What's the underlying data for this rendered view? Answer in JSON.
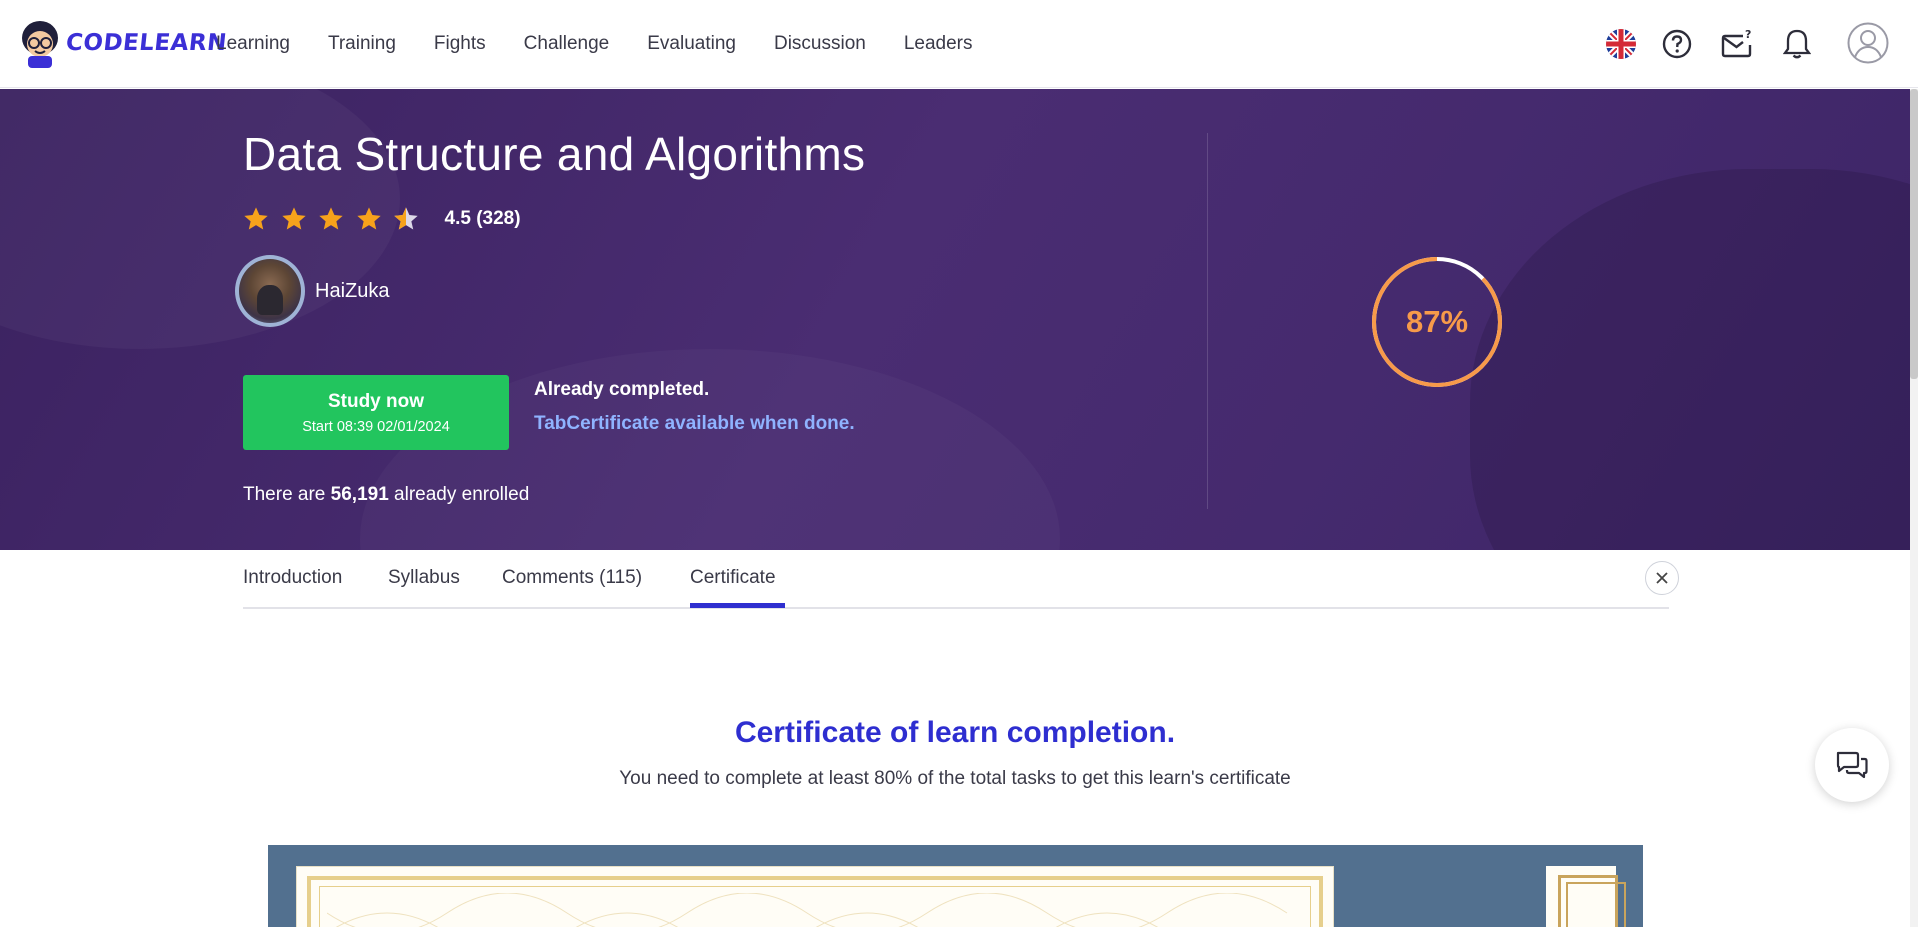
{
  "brand": {
    "name": "CODELEARN"
  },
  "nav": {
    "items": [
      {
        "label": "Learning"
      },
      {
        "label": "Training"
      },
      {
        "label": "Fights"
      },
      {
        "label": "Challenge"
      },
      {
        "label": "Evaluating"
      },
      {
        "label": "Discussion"
      },
      {
        "label": "Leaders"
      }
    ]
  },
  "header_icons": [
    "uk-flag-icon",
    "help-icon",
    "mail-icon",
    "bell-icon",
    "user-avatar-icon"
  ],
  "course": {
    "title": "Data Structure and Algorithms",
    "rating": 4.5,
    "rating_text": "4.5 (328)",
    "author": "HaiZuka",
    "study_button": {
      "label": "Study now",
      "sublabel": "Start 08:39 02/01/2024"
    },
    "status": "Already completed.",
    "certificate_note": "TabCertificate available when done.",
    "enrolled_prefix": "There are ",
    "enrolled_count": "56,191",
    "enrolled_suffix": " already enrolled",
    "progress_percent": 87,
    "progress_label": "87%"
  },
  "tabs": [
    {
      "label": "Introduction"
    },
    {
      "label": "Syllabus"
    },
    {
      "label": "Comments (115)"
    },
    {
      "label": "Certificate",
      "active": true
    }
  ],
  "certificate": {
    "title": "Certificate of learn completion.",
    "description": "You need to complete at least 80% of the total tasks to get this learn's certificate"
  },
  "colors": {
    "brand": "#3b2fd6",
    "hero_bg": "#4a2d72",
    "study_button": "#22c55e",
    "progress": "#f79a4a",
    "link": "#8fb3ff",
    "tab_active": "#2f2fcf",
    "cert_title": "#2e2ed0"
  }
}
